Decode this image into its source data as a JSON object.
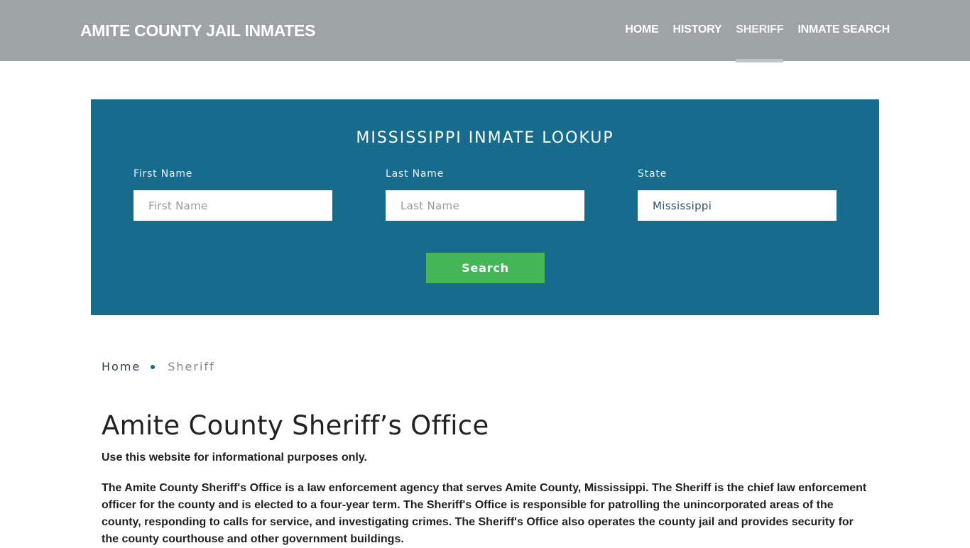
{
  "header": {
    "brand": "AMITE COUNTY JAIL INMATES",
    "nav": [
      {
        "label": "HOME",
        "active": false
      },
      {
        "label": "HISTORY",
        "active": false
      },
      {
        "label": "SHERIFF",
        "active": true
      },
      {
        "label": "INMATE SEARCH",
        "active": false
      }
    ]
  },
  "lookup": {
    "title": "MISSISSIPPI INMATE LOOKUP",
    "first_name": {
      "label": "First Name",
      "placeholder": "First Name",
      "value": ""
    },
    "last_name": {
      "label": "Last Name",
      "placeholder": "Last Name",
      "value": ""
    },
    "state": {
      "label": "State",
      "value": "Mississippi"
    },
    "search_label": "Search",
    "colors": {
      "panel": "#176b8c",
      "button": "#44b657"
    }
  },
  "breadcrumb": {
    "home": "Home",
    "current": "Sheriff"
  },
  "content": {
    "title": "Amite County Sheriff’s Office",
    "disclaimer": "Use this website for informational purposes only.",
    "paragraph": "The Amite County Sheriff's Office is a law enforcement agency that serves Amite County, Mississippi. The Sheriff is the chief law enforcement officer for the county and is elected to a four-year term. The Sheriff's Office is responsible for patrolling the unincorporated areas of the county, responding to calls for service, and investigating crimes. The Sheriff's Office also operates the county jail and provides security for the county courthouse and other government buildings."
  }
}
